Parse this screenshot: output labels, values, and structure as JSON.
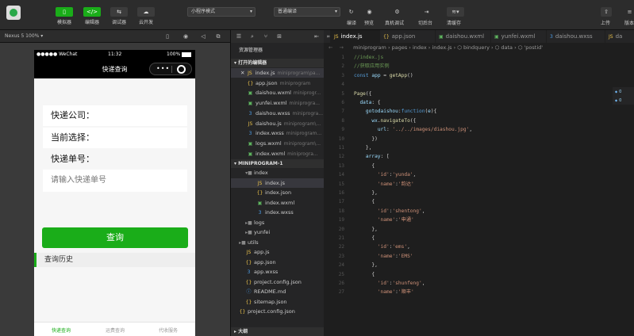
{
  "toolbar": {
    "simulator_label": "模拟器",
    "editor_label": "编辑器",
    "debugger_label": "调试器",
    "cloud_label": "云开发",
    "mode_select": "小程序模式",
    "compile_select": "普通编译",
    "compile_label": "编译",
    "preview_label": "预览",
    "real_debug_label": "真机调试",
    "backend_label": "切后台",
    "cache_label": "清缓存",
    "upload_label": "上传",
    "version_label": "版本"
  },
  "simulator": {
    "device": "Nexus 5 100% ▾",
    "status": {
      "carrier": "●●●●● WeChat",
      "time": "11:32",
      "battery": "100%"
    },
    "nav_title": "快递查询",
    "labels": {
      "company": "快递公司：",
      "current": "当前选择：",
      "number": "快递单号："
    },
    "input_placeholder": "请输入快递单号",
    "query_button": "查询",
    "history": "查询历史",
    "tabs": [
      "快递查询",
      "运费查询",
      "代收服务"
    ]
  },
  "explorer": {
    "title": "资源管理器",
    "open_editors_header": "▾ 打开的编辑器",
    "open_editors": [
      {
        "name": "index.js",
        "path": "miniprogram\\pa...",
        "type": "js",
        "close": "✕"
      },
      {
        "name": "app.json",
        "path": "miniprogram",
        "type": "json"
      },
      {
        "name": "daishou.wxml",
        "path": "miniprogr...",
        "type": "wxml"
      },
      {
        "name": "yunfei.wxml",
        "path": "miniprogra...",
        "type": "wxml"
      },
      {
        "name": "daishou.wxss",
        "path": "miniprogra...",
        "type": "wxss"
      },
      {
        "name": "daishou.js",
        "path": "miniprogram\\...",
        "type": "js"
      },
      {
        "name": "index.wxss",
        "path": "miniprogram...",
        "type": "wxss"
      },
      {
        "name": "logs.wxml",
        "path": "miniprogram\\...",
        "type": "wxml"
      },
      {
        "name": "index.wxml",
        "path": "miniprogra...",
        "type": "wxml"
      }
    ],
    "project_header": "▾ MINIPROGRAM-1",
    "tree": [
      {
        "name": "miniprogram",
        "type": "folder-open"
      },
      {
        "name": "index",
        "type": "folder-open"
      },
      {
        "name": "index.js",
        "type": "js"
      },
      {
        "name": "index.json",
        "type": "json"
      },
      {
        "name": "index.wxml",
        "type": "wxml"
      },
      {
        "name": "index.wxss",
        "type": "wxss"
      },
      {
        "name": "logs",
        "type": "folder"
      },
      {
        "name": "yunfei",
        "type": "folder"
      },
      {
        "name": "utils",
        "type": "folder"
      },
      {
        "name": "app.js",
        "type": "js"
      },
      {
        "name": "app.json",
        "type": "json"
      },
      {
        "name": "app.wxss",
        "type": "wxss"
      },
      {
        "name": "project.config.json",
        "type": "json"
      },
      {
        "name": "README.md",
        "type": "md"
      },
      {
        "name": "sitemap.json",
        "type": "json"
      },
      {
        "name": "project.config.json",
        "type": "json"
      }
    ],
    "outline_header": "▸ 大纲"
  },
  "editor": {
    "tabs": [
      "index.js",
      "app.json",
      "daishou.wxml",
      "yunfei.wxml",
      "daishou.wxss",
      "da"
    ],
    "breadcrumb": "miniprogram › pages › index ›  index.js › ⬡ bindquery › ⬡ data › ⬡ 'postid'",
    "lines": [
      "//index.js",
      "//获取应用实例",
      "const app = getApp()",
      "",
      "Page({",
      "  data: {",
      "    gotodaishou:function(e){",
      "      wx.navigateTo({",
      "        url: '../../images/diashou.jpg',",
      "      })",
      "    },",
      "    array: [",
      "      {",
      "        'id':'yunda',",
      "        'name':'韵达'",
      "      },",
      "      {",
      "        'id':'shentong',",
      "        'name':'申通'",
      "      },",
      "      {",
      "        'id':'ems',",
      "        'name':'EMS'",
      "      },",
      "      {",
      "        'id':'shunfeng',",
      "        'name':'顺丰'"
    ],
    "minimap": [
      "0",
      "0"
    ]
  }
}
